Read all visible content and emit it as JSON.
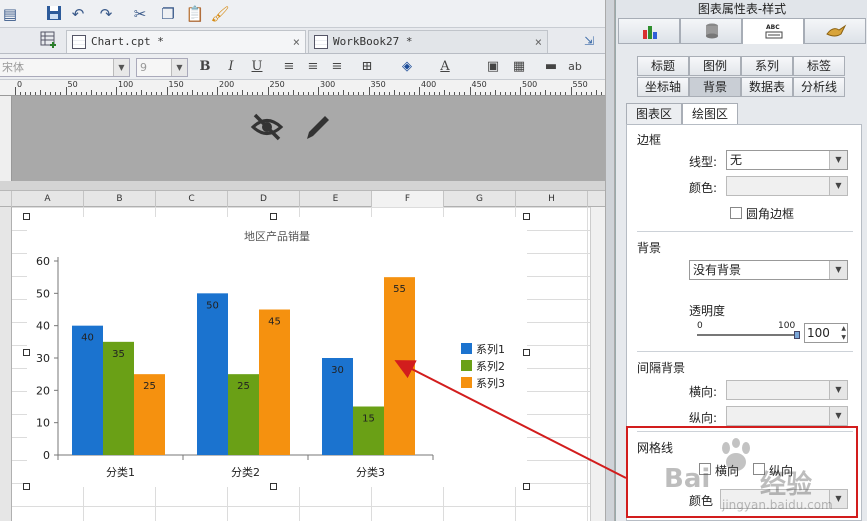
{
  "toolbar": {
    "icons": [
      "save-icon",
      "undo-icon",
      "redo-icon",
      "cut-icon",
      "copy-icon",
      "paste-icon",
      "format-brush-icon"
    ]
  },
  "tabs": [
    {
      "label": "Chart.cpt *",
      "close": "×"
    },
    {
      "label": "WorkBook27 *",
      "close": "×"
    }
  ],
  "format_bar": {
    "font_value": "宋体",
    "size_value": "9",
    "bold": "B",
    "italic": "I",
    "underline": "U",
    "abc": "ab"
  },
  "ruler": {
    "ticks": [
      "0",
      "50",
      "100",
      "150",
      "200",
      "250",
      "300",
      "350",
      "400",
      "450",
      "500",
      "550"
    ]
  },
  "columns": [
    "A",
    "B",
    "C",
    "D",
    "E",
    "F",
    "G",
    "H"
  ],
  "chart_data": {
    "type": "bar",
    "title": "地区产品销量",
    "categories": [
      "分类1",
      "分类2",
      "分类3"
    ],
    "series": [
      {
        "name": "系列1",
        "values": [
          40,
          50,
          30
        ],
        "color": "#1b73cf"
      },
      {
        "name": "系列2",
        "values": [
          35,
          25,
          15
        ],
        "color": "#6aa016"
      },
      {
        "name": "系列3",
        "values": [
          25,
          45,
          55
        ],
        "color": "#f5910f"
      }
    ],
    "ylim": [
      0,
      60
    ],
    "yticks": [
      "0",
      "10",
      "20",
      "30",
      "40",
      "50",
      "60"
    ],
    "xlabel": "",
    "ylabel": "",
    "legend": "right",
    "grid": false
  },
  "panel": {
    "title": "图表属性表-样式",
    "top_tabs": [
      "chart-type-icon",
      "data-icon",
      "style-icon",
      "special-effect-icon"
    ],
    "style_tabs_row1": [
      "标题",
      "图例",
      "系列",
      "标签"
    ],
    "style_tabs_row2": [
      "坐标轴",
      "背景",
      "数据表",
      "分析线"
    ],
    "area_tabs": [
      "图表区",
      "绘图区"
    ],
    "border": {
      "section": "边框",
      "line_label": "线型:",
      "line_value": "无",
      "color_label": "颜色:",
      "rounded_label": "圆角边框"
    },
    "background": {
      "section": "背景",
      "value": "没有背景",
      "transparency_label": "透明度",
      "slider_min": "0",
      "slider_max": "100",
      "transparency_value": "100",
      "transparency": 1.0
    },
    "interval": {
      "section": "间隔背景",
      "horizontal_label": "横向:",
      "vertical_label": "纵向:"
    },
    "gridlines": {
      "section": "网格线",
      "horizontal_label": "横向",
      "vertical_label": "纵向",
      "color_label": "颜色"
    }
  },
  "watermark": {
    "brand": "Bai",
    "text": "经验",
    "url": "jingyan.baidu.com"
  },
  "annotation_color": "#d21d1d"
}
